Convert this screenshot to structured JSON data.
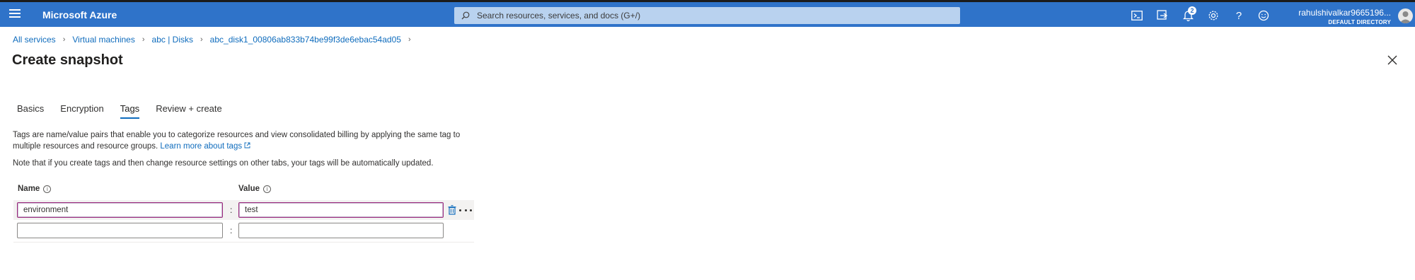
{
  "header": {
    "brand": "Microsoft Azure",
    "search_placeholder": "Search resources, services, and docs (G+/)",
    "notifications_count": "2",
    "user_name": "rahulshivalkar9665196...",
    "directory": "DEFAULT DIRECTORY",
    "icons": [
      "menu-icon",
      "cloud-shell-icon",
      "directory-filter-icon",
      "notifications-icon",
      "settings-icon",
      "help-icon",
      "feedback-icon"
    ]
  },
  "breadcrumb": [
    {
      "label": "All services"
    },
    {
      "label": "Virtual machines"
    },
    {
      "label": "abc | Disks"
    },
    {
      "label": "abc_disk1_00806ab833b74be99f3de6ebac54ad05"
    }
  ],
  "page": {
    "title": "Create snapshot"
  },
  "tabs": [
    {
      "label": "Basics",
      "active": false
    },
    {
      "label": "Encryption",
      "active": false
    },
    {
      "label": "Tags",
      "active": true
    },
    {
      "label": "Review + create",
      "active": false
    }
  ],
  "tags_section": {
    "description": "Tags are name/value pairs that enable you to categorize resources and view consolidated billing by applying the same tag to multiple resources and resource groups.",
    "learn_more": "Learn more about tags",
    "note": "Note that if you create tags and then change resource settings on other tabs, your tags will be automatically updated.",
    "name_header": "Name",
    "value_header": "Value",
    "rows": [
      {
        "name": "environment",
        "value": "test",
        "separator": ":"
      },
      {
        "name": "",
        "value": "",
        "separator": ":"
      }
    ]
  },
  "colors": {
    "topbar": "#2f73c9",
    "link": "#0f6cbd",
    "active_field_border": "#9b2a7e"
  }
}
